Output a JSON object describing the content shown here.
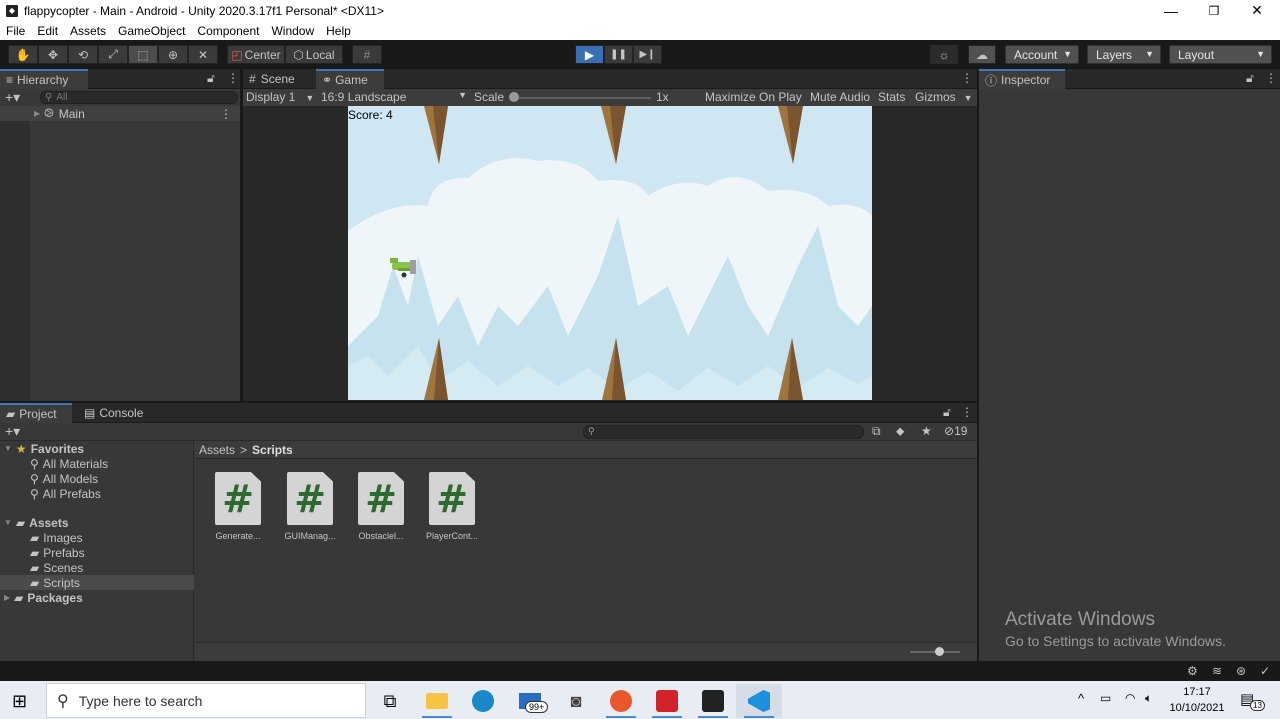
{
  "window": {
    "title": "flappycopter - Main - Android - Unity 2020.3.17f1 Personal* <DX11>",
    "minimize": "—",
    "restore": "❐",
    "close": "✕"
  },
  "menu": [
    "File",
    "Edit",
    "Assets",
    "GameObject",
    "Component",
    "Window",
    "Help"
  ],
  "toolbar": {
    "pivot_center": "Center",
    "pivot_local": "Local",
    "account": "Account",
    "layers": "Layers",
    "layout": "Layout"
  },
  "hierarchy": {
    "tab": "Hierarchy",
    "search_placeholder": "All",
    "scene_item": "Main"
  },
  "scene_game": {
    "tab_scene": "Scene",
    "tab_game": "Game",
    "display": "Display 1",
    "aspect": "16:9 Landscape",
    "scale_label": "Scale",
    "scale_value": "1x",
    "maximize": "Maximize On Play",
    "mute": "Mute Audio",
    "stats": "Stats",
    "gizmos": "Gizmos",
    "score": "Score: 4"
  },
  "inspector": {
    "tab": "Inspector"
  },
  "project": {
    "tab_project": "Project",
    "tab_console": "Console",
    "hidden_count": "19",
    "breadcrumb": [
      "Assets",
      "Scripts"
    ],
    "favorites_label": "Favorites",
    "favorites": [
      "All Materials",
      "All Models",
      "All Prefabs"
    ],
    "assets_label": "Assets",
    "asset_folders": [
      "Images",
      "Prefabs",
      "Scenes",
      "Scripts"
    ],
    "packages_label": "Packages",
    "scripts": [
      "Generate...",
      "GUIManag...",
      "Obstaclel...",
      "PlayerCont..."
    ]
  },
  "watermark": {
    "line1": "Activate Windows",
    "line2": "Go to Settings to activate Windows."
  },
  "taskbar": {
    "search_placeholder": "Type here to search",
    "mail_badge": "99+",
    "time": "17:17",
    "date": "10/10/2021",
    "notification_count": "13"
  },
  "colors": {
    "play_button": "#3b6fb4",
    "game_sky": "#cfe7f2",
    "script_hash": "#2e6930",
    "spike": "#a0743f"
  }
}
